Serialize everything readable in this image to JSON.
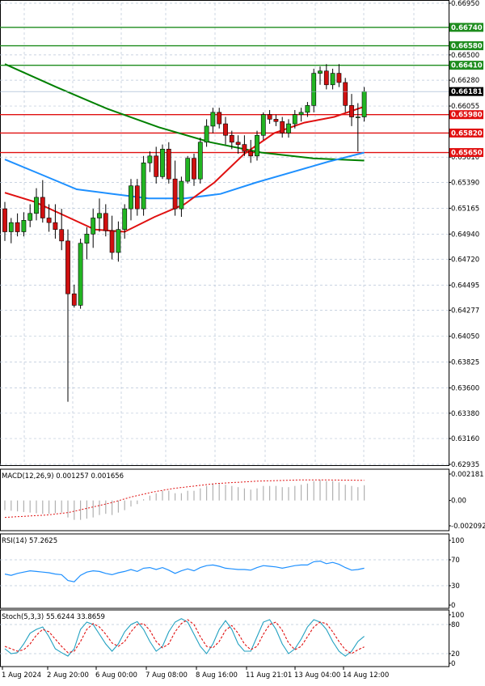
{
  "chart_data": [
    {
      "type": "candlestick",
      "title": "",
      "price_axis": [
        "0.66950",
        "0.66500",
        "0.66280",
        "0.66055",
        "0.65610",
        "0.65390",
        "0.65165",
        "0.64940",
        "0.64720",
        "0.64495",
        "0.64277",
        "0.64050",
        "0.63825",
        "0.63600",
        "0.63380",
        "0.63160",
        "0.62935"
      ],
      "ylim": [
        0.62935,
        0.6695
      ],
      "current_price": "0.66181",
      "horizontal_levels": [
        {
          "label": "0.66740",
          "value": 0.6674,
          "color": "#1e8c1e"
        },
        {
          "label": "0.66580",
          "value": 0.6658,
          "color": "#1e8c1e"
        },
        {
          "label": "0.66410",
          "value": 0.6641,
          "color": "#1e8c1e"
        },
        {
          "label": "0.65980",
          "value": 0.6598,
          "color": "#e01010"
        },
        {
          "label": "0.65820",
          "value": 0.6582,
          "color": "#e01010"
        },
        {
          "label": "0.65650",
          "value": 0.6565,
          "color": "#e01010"
        }
      ],
      "candles": [
        [
          0.6516,
          0.6522,
          0.6488,
          0.6496
        ],
        [
          0.6496,
          0.6508,
          0.6486,
          0.6504
        ],
        [
          0.6504,
          0.6512,
          0.6492,
          0.6496
        ],
        [
          0.6496,
          0.6513,
          0.6492,
          0.6506
        ],
        [
          0.6506,
          0.652,
          0.65,
          0.6512
        ],
        [
          0.6512,
          0.6534,
          0.6506,
          0.6526
        ],
        [
          0.6526,
          0.6541,
          0.6504,
          0.6508
        ],
        [
          0.6508,
          0.652,
          0.6496,
          0.6504
        ],
        [
          0.6504,
          0.652,
          0.649,
          0.6498
        ],
        [
          0.6498,
          0.6516,
          0.648,
          0.6488
        ],
        [
          0.6488,
          0.6498,
          0.6348,
          0.6442
        ],
        [
          0.6442,
          0.645,
          0.643,
          0.6432
        ],
        [
          0.6432,
          0.649,
          0.6429,
          0.6486
        ],
        [
          0.6486,
          0.65,
          0.6472,
          0.6494
        ],
        [
          0.6494,
          0.6516,
          0.6482,
          0.6508
        ],
        [
          0.6508,
          0.6525,
          0.6496,
          0.6512
        ],
        [
          0.6512,
          0.652,
          0.6492,
          0.6497
        ],
        [
          0.6497,
          0.651,
          0.6472,
          0.6478
        ],
        [
          0.6478,
          0.6505,
          0.647,
          0.6498
        ],
        [
          0.6498,
          0.652,
          0.649,
          0.6516
        ],
        [
          0.6516,
          0.6542,
          0.6506,
          0.6536
        ],
        [
          0.6536,
          0.6542,
          0.651,
          0.6516
        ],
        [
          0.6516,
          0.6562,
          0.651,
          0.6556
        ],
        [
          0.6556,
          0.6566,
          0.6548,
          0.6562
        ],
        [
          0.6562,
          0.657,
          0.6538,
          0.6544
        ],
        [
          0.6544,
          0.6572,
          0.6542,
          0.6568
        ],
        [
          0.6568,
          0.6574,
          0.6538,
          0.6542
        ],
        [
          0.6542,
          0.6558,
          0.651,
          0.6516
        ],
        [
          0.6516,
          0.6544,
          0.6509,
          0.654
        ],
        [
          0.654,
          0.6562,
          0.6538,
          0.656
        ],
        [
          0.656,
          0.6564,
          0.6536,
          0.6542
        ],
        [
          0.6542,
          0.6578,
          0.6538,
          0.6574
        ],
        [
          0.6574,
          0.6594,
          0.657,
          0.6588
        ],
        [
          0.6588,
          0.6604,
          0.6582,
          0.66
        ],
        [
          0.66,
          0.6604,
          0.6586,
          0.659
        ],
        [
          0.659,
          0.6596,
          0.6572,
          0.658
        ],
        [
          0.658,
          0.6584,
          0.6568,
          0.6574
        ],
        [
          0.6574,
          0.658,
          0.6564,
          0.6572
        ],
        [
          0.6572,
          0.658,
          0.6562,
          0.6566
        ],
        [
          0.6566,
          0.6576,
          0.6556,
          0.6562
        ],
        [
          0.6562,
          0.6584,
          0.6558,
          0.658
        ],
        [
          0.658,
          0.66,
          0.6576,
          0.6598
        ],
        [
          0.6598,
          0.6602,
          0.659,
          0.6594
        ],
        [
          0.6594,
          0.6598,
          0.6588,
          0.6592
        ],
        [
          0.6592,
          0.6596,
          0.6578,
          0.6582
        ],
        [
          0.6582,
          0.6594,
          0.6578,
          0.659
        ],
        [
          0.659,
          0.6602,
          0.6586,
          0.6598
        ],
        [
          0.6598,
          0.6604,
          0.6592,
          0.66
        ],
        [
          0.66,
          0.6609,
          0.6596,
          0.6606
        ],
        [
          0.6606,
          0.6638,
          0.66,
          0.6634
        ],
        [
          0.6634,
          0.664,
          0.6624,
          0.6636
        ],
        [
          0.6636,
          0.6642,
          0.662,
          0.6624
        ],
        [
          0.6624,
          0.6638,
          0.662,
          0.6634
        ],
        [
          0.6634,
          0.6642,
          0.6622,
          0.6626
        ],
        [
          0.6626,
          0.663,
          0.66,
          0.6606
        ],
        [
          0.6606,
          0.6616,
          0.6588,
          0.6596
        ],
        [
          0.6596,
          0.6608,
          0.6566,
          0.6596
        ],
        [
          0.6596,
          0.6622,
          0.6592,
          0.66181
        ]
      ],
      "moving_averages": [
        {
          "color": "#008000",
          "values": [
            0.6642,
            0.6622,
            0.6603,
            0.6587,
            0.6574,
            0.6565,
            0.656,
            0.6558
          ]
        },
        {
          "color": "#1e90ff",
          "values": [
            0.6559,
            0.6546,
            0.6533,
            0.6529,
            0.6525,
            0.6525,
            0.6529,
            0.6539,
            0.6548,
            0.6557,
            0.6565
          ]
        },
        {
          "color": "#e01010",
          "values": [
            0.653,
            0.6522,
            0.651,
            0.6498,
            0.6496,
            0.6509,
            0.652,
            0.6539,
            0.6564,
            0.6582,
            0.6591,
            0.6596,
            0.6605
          ]
        }
      ],
      "x_labels": [
        "1 Aug 2024",
        "2 Aug 20:00",
        "6 Aug 00:00",
        "7 Aug 08:00",
        "8 Aug 16:00",
        "11 Aug 21:01",
        "13 Aug 04:00",
        "14 Aug 12:00"
      ]
    },
    {
      "type": "macd",
      "title": "MACD(12,26,9) 0.001257 0.001656",
      "ylim": [
        -0.002092,
        0.002181
      ],
      "y_ticks": [
        "0.002181",
        "0.00",
        "-0.002092"
      ],
      "histogram": [
        -0.0008,
        -0.00085,
        -0.0009,
        -0.00095,
        -0.001,
        -0.00105,
        -0.0011,
        -0.0011,
        -0.00105,
        -0.001,
        -0.0014,
        -0.0016,
        -0.0016,
        -0.0015,
        -0.0014,
        -0.0012,
        -0.0011,
        -0.0012,
        -0.001,
        -0.0008,
        -0.0005,
        -0.0003,
        0.0001,
        0.0004,
        0.0006,
        0.0008,
        0.0008,
        0.0006,
        0.0006,
        0.0008,
        0.0008,
        0.001,
        0.0012,
        0.0014,
        0.0014,
        0.0013,
        0.0012,
        0.0011,
        0.001,
        0.0009,
        0.001,
        0.0012,
        0.0012,
        0.0012,
        0.0011,
        0.0011,
        0.0012,
        0.0013,
        0.0014,
        0.0016,
        0.0017,
        0.0016,
        0.0016,
        0.0015,
        0.0013,
        0.0012,
        0.0011,
        0.00126
      ],
      "signal": [
        -0.0014,
        -0.0013,
        -0.0012,
        -0.001,
        -0.0006,
        -0.0002,
        0.0003,
        0.0007,
        0.001,
        0.0012,
        0.0014,
        0.0015,
        0.0016,
        0.00165,
        0.0017,
        0.0017,
        0.00168,
        0.00166
      ]
    },
    {
      "type": "line",
      "title": "RSI(14) 57.2625",
      "ylim": [
        0,
        100
      ],
      "y_ticks": [
        "100",
        "70",
        "30",
        "0"
      ],
      "values": [
        48,
        46,
        49,
        51,
        53,
        52,
        51,
        50,
        48,
        47,
        38,
        36,
        46,
        51,
        53,
        52,
        49,
        47,
        50,
        52,
        55,
        52,
        57,
        58,
        55,
        58,
        54,
        49,
        53,
        56,
        53,
        58,
        61,
        62,
        60,
        57,
        56,
        55,
        55,
        54,
        58,
        61,
        60,
        59,
        57,
        59,
        61,
        62,
        62,
        67,
        68,
        64,
        66,
        63,
        58,
        54,
        55,
        57
      ]
    },
    {
      "type": "line",
      "title": "Stoch(5,3,3) 55.6244 33.8659",
      "ylim": [
        0,
        100
      ],
      "y_ticks": [
        "100",
        "80",
        "20",
        "0"
      ],
      "k": [
        30,
        20,
        22,
        40,
        62,
        70,
        75,
        55,
        30,
        22,
        15,
        30,
        70,
        85,
        80,
        60,
        40,
        25,
        40,
        65,
        80,
        86,
        70,
        45,
        25,
        35,
        65,
        85,
        92,
        85,
        60,
        35,
        20,
        40,
        70,
        88,
        70,
        40,
        25,
        25,
        55,
        85,
        90,
        70,
        40,
        20,
        30,
        50,
        75,
        90,
        85,
        70,
        45,
        25,
        15,
        25,
        45,
        55.6
      ],
      "d": [
        35,
        30,
        25,
        28,
        40,
        58,
        70,
        65,
        50,
        35,
        22,
        25,
        45,
        70,
        82,
        75,
        60,
        42,
        35,
        45,
        65,
        80,
        82,
        68,
        45,
        32,
        40,
        65,
        82,
        90,
        80,
        55,
        35,
        32,
        45,
        68,
        78,
        62,
        40,
        28,
        35,
        60,
        80,
        85,
        68,
        42,
        28,
        35,
        55,
        75,
        85,
        82,
        65,
        45,
        28,
        20,
        28,
        33.9
      ]
    }
  ]
}
